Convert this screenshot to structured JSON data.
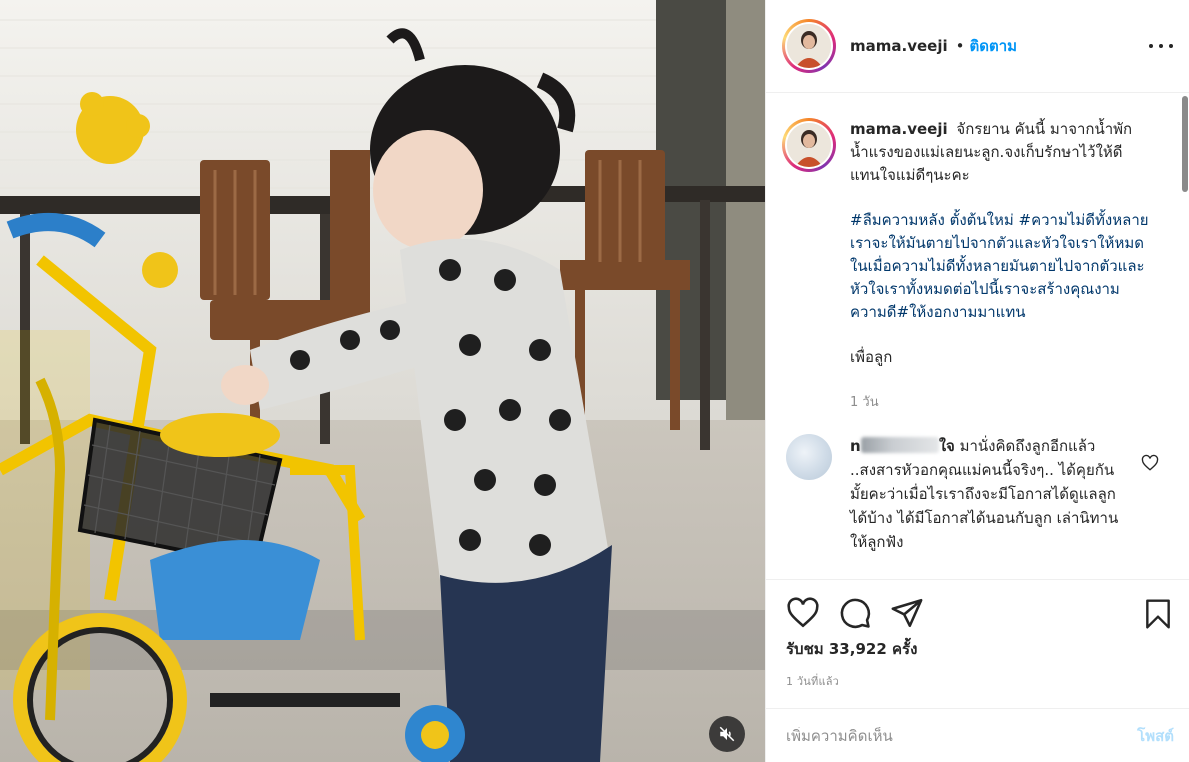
{
  "header": {
    "username": "mama.veeji",
    "separator": "•",
    "follow_label": "ติดตาม",
    "more_icon": "more-options-icon"
  },
  "caption": {
    "username": "mama.veeji",
    "text": "จักรยาน คันนี้ มาจากน้ำพักน้ำแรงของแม่เลยนะลูก.จงเก็บรักษาไว้ให้ดีแทนใจแม่ดีๆนะคะ",
    "hashtags": "#ลืมความหลัง ตั้งต้นใหม่ #ความไม่ดีทั้งหลายเราจะให้มันตายไปจากตัวและหัวใจเราให้หมดในเมื่อความไม่ดีทั้งหลายมันตายไปจากตัวและหัวใจเราทั้งหมดต่อไปนี้เราจะสร้างคุณงามความดี#ให้งอกงามมาแทน",
    "closing": "เพื่อลูก",
    "age": "1 วัน"
  },
  "comment": {
    "username_visible": "n",
    "username_tail": "ใจ",
    "text": "มานั่งคิดถึงลูกอีกแล้ว ..สงสารหัวอกคุณแม่คนนี้จริงๆ.. ได้คุยกันมั้ยคะว่าเมื่อไรเราถึงจะมีโอกาสได้ดูแลลูกได้บ้าง ได้มีโอกาสได้นอนกับลูก เล่านิทานให้ลูกฟัง"
  },
  "actions": {
    "icons": [
      "heart-icon",
      "comment-icon",
      "share-icon",
      "bookmark-icon"
    ],
    "views": "รับชม 33,922 ครั้ง",
    "posted": "1 วันที่แล้ว"
  },
  "add_comment": {
    "placeholder": "เพิ่มความคิดเห็น",
    "post_label": "โพสต์"
  },
  "media": {
    "mute_icon": "muted-speaker-icon"
  },
  "colors": {
    "link_blue": "#0095f6",
    "hashtag_blue": "#00376b",
    "post_disabled": "#b2dffc",
    "muted_text": "#8e8e8e"
  }
}
